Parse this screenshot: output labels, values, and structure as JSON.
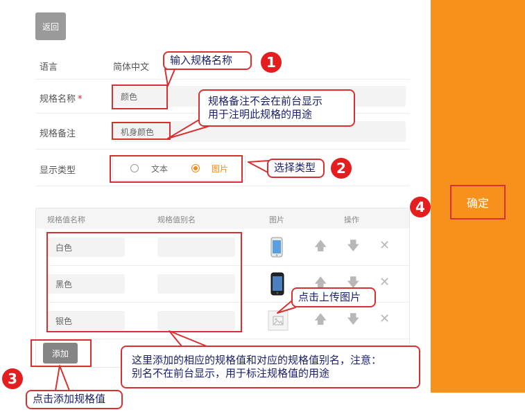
{
  "toolbar": {
    "back_label": "返回"
  },
  "form": {
    "language_label": "语言",
    "language_value": "简体中文",
    "spec_name_label": "规格名称",
    "required_mark": "*",
    "spec_name_value": "颜色",
    "spec_note_label": "规格备注",
    "spec_note_value": "机身颜色",
    "display_type_label": "显示类型",
    "display_options": [
      {
        "label": "文本",
        "checked": false
      },
      {
        "label": "图片",
        "checked": true
      }
    ]
  },
  "table": {
    "headers": [
      "规格值名称",
      "规格值别名",
      "图片",
      "操作"
    ],
    "rows": [
      {
        "name": "白色",
        "alias": "",
        "image": "phone-white-icon"
      },
      {
        "name": "黑色",
        "alias": "",
        "image": "phone-black-icon"
      },
      {
        "name": "银色",
        "alias": "",
        "image": "image-placeholder-icon"
      }
    ],
    "add_label": "添加"
  },
  "sidebar": {
    "confirm_label": "确定"
  },
  "annotations": {
    "callout_1": "输入规格名称",
    "callout_note_line1": "规格备注不会在前台显示",
    "callout_note_line2": "用于注明此规格的用途",
    "callout_2": "选择类型",
    "callout_upload": "点击上传图片",
    "callout_values_line1": "这里添加的相应的规格值和对应的规格值别名，注意：",
    "callout_values_line2": "别名不在前台显示，用于标注规格值的用途",
    "callout_3": "点击添加规格值",
    "numbers": [
      "1",
      "2",
      "3",
      "4"
    ]
  },
  "colors": {
    "accent": "#f6911e",
    "highlight": "#d83030",
    "badge": "#e41e1e",
    "callout_text": "#1a1f6b"
  }
}
